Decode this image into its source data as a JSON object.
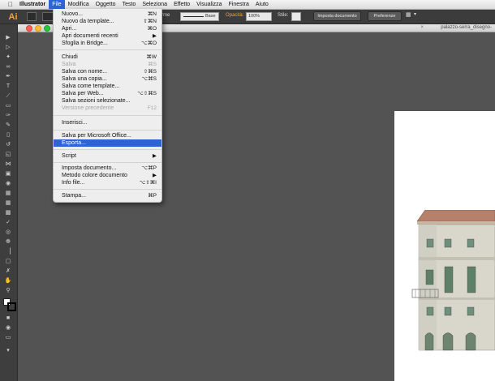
{
  "menubar": {
    "apple": "",
    "items": [
      "Illustrator",
      "File",
      "Modifica",
      "Oggetto",
      "Testo",
      "Seleziona",
      "Effetto",
      "Visualizza",
      "Finestra",
      "Aiuto"
    ]
  },
  "controlbar": {
    "logo": "Ai",
    "forma_label": "rme",
    "stroke_style": "Base",
    "opacity_label": "Opacità:",
    "opacity_value": "100%",
    "style_label": "Stile:",
    "doc_setup_button": "Imposta documento",
    "preferences_button": "Preferenze"
  },
  "document": {
    "tab_title": "palazzo-serra_disegno-"
  },
  "file_menu": {
    "items": [
      {
        "label": "Nuovo...",
        "shortcut": "⌘N"
      },
      {
        "label": "Nuovo da template...",
        "shortcut": "⇧⌘N"
      },
      {
        "label": "Apri...",
        "shortcut": "⌘O"
      },
      {
        "label": "Apri documenti recenti",
        "shortcut": "▶"
      },
      {
        "label": "Sfoglia in Bridge...",
        "shortcut": "⌥⌘O"
      },
      {
        "label": "Chiudi",
        "shortcut": "⌘W"
      },
      {
        "label": "Salva",
        "shortcut": "⌘S"
      },
      {
        "label": "Salva con nome...",
        "shortcut": "⇧⌘S"
      },
      {
        "label": "Salva una copia...",
        "shortcut": "⌥⌘S"
      },
      {
        "label": "Salva come template...",
        "shortcut": ""
      },
      {
        "label": "Salva per Web...",
        "shortcut": "⌥⇧⌘S"
      },
      {
        "label": "Salva sezioni selezionate...",
        "shortcut": ""
      },
      {
        "label": "Versione precedente",
        "shortcut": "F12"
      },
      {
        "label": "Inserisci...",
        "shortcut": ""
      },
      {
        "label": "Salva per Microsoft Office...",
        "shortcut": ""
      },
      {
        "label": "Esporta...",
        "shortcut": ""
      },
      {
        "label": "Script",
        "shortcut": "▶"
      },
      {
        "label": "Imposta documento...",
        "shortcut": "⌥⌘P"
      },
      {
        "label": "Metodo colore documento",
        "shortcut": "▶"
      },
      {
        "label": "Info file...",
        "shortcut": "⌥⇧⌘I"
      },
      {
        "label": "Stampa...",
        "shortcut": "⌘P"
      }
    ]
  },
  "colors": {
    "highlight": "#2f62d6",
    "canvas": "#535353",
    "menu_bg": "#eeeeee",
    "ai_orange": "#f3a52b"
  }
}
